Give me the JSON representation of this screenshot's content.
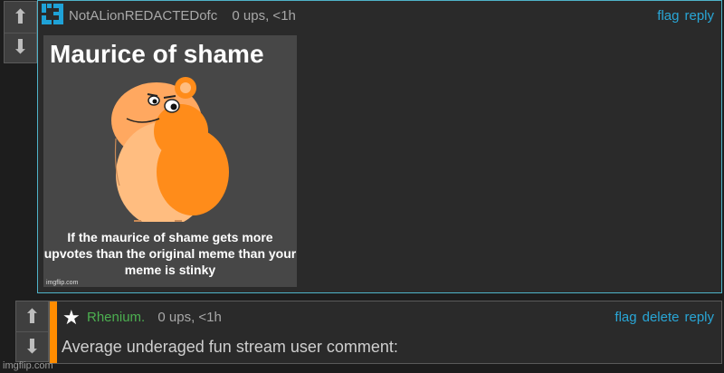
{
  "comment1": {
    "author": "NotALionREDACTEDofc",
    "meta": "0 ups, <1h",
    "links": [
      "flag",
      "reply"
    ],
    "meme": {
      "title": "Maurice of shame",
      "caption": "If the maurice of shame gets more upvotes than the original meme than your meme is stinky",
      "watermark": "imgflip.com"
    }
  },
  "comment2": {
    "author": "Rhenium.",
    "meta": "0 ups, <1h",
    "links": [
      "flag",
      "delete",
      "reply"
    ],
    "text": "Average underaged fun stream user comment:"
  },
  "footer": {
    "watermark": "imgflip.com"
  },
  "colors": {
    "accent_link": "#29a6d6",
    "reply_stripe": "#ff8c00",
    "author2": "#4caf50"
  }
}
